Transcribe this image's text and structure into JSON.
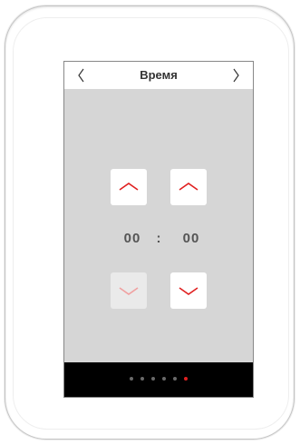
{
  "header": {
    "title": "Время"
  },
  "time": {
    "hours": "00",
    "separator": ":",
    "minutes": "00"
  },
  "controls": {
    "hours_up": {
      "icon": "chevron-up-icon",
      "enabled": true
    },
    "minutes_up": {
      "icon": "chevron-up-icon",
      "enabled": true
    },
    "hours_down": {
      "icon": "chevron-down-icon",
      "enabled": false
    },
    "minutes_down": {
      "icon": "chevron-down-icon",
      "enabled": true
    }
  },
  "pagination": {
    "page_count": 6,
    "active_page": 6
  },
  "colors": {
    "accent": "#e02020",
    "screen_background": "#d6d6d6",
    "header_background": "#ffffff",
    "footer_background": "#000000",
    "inactive_dot": "#6a6a6a",
    "text": "#555555"
  }
}
